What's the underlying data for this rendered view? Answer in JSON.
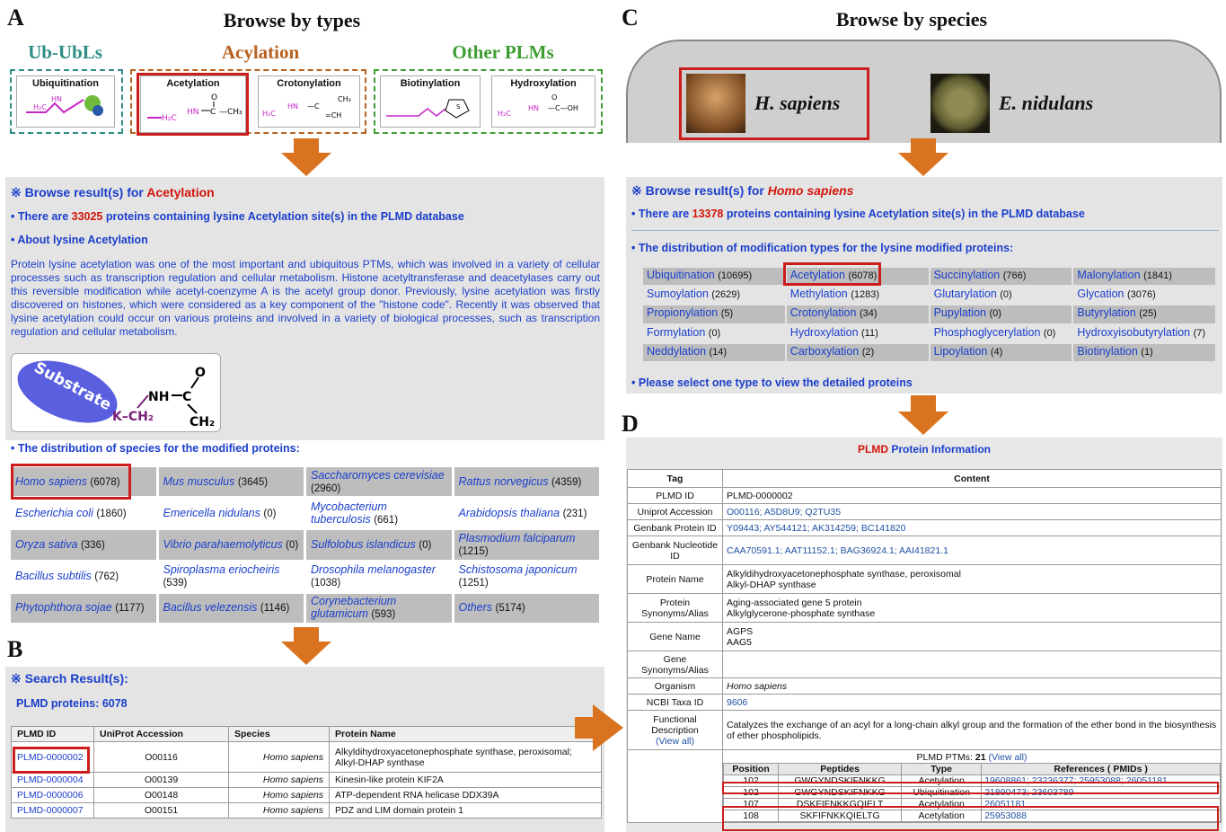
{
  "panels": {
    "a": "A",
    "b": "B",
    "c": "C",
    "d": "D"
  },
  "browse_types": {
    "title": "Browse by types",
    "categories": [
      {
        "label": "Ub-UbLs",
        "color": "#2e8d84"
      },
      {
        "label": "Acylation",
        "color": "#b8611e"
      },
      {
        "label": "Other PLMs",
        "color": "#3f9e33"
      }
    ],
    "types": [
      "Ubiquitination",
      "Acetylation",
      "Crotonylation",
      "Biotinylation",
      "Hydroxylation"
    ]
  },
  "acetyl_result": {
    "heading_prefix": "※ Browse result(s) for ",
    "heading_type": "Acetylation",
    "count_line_pre": "There are ",
    "count": "33025",
    "count_line_post": " proteins containing lysine Acetylation site(s) in the PLMD database",
    "about_heading": "About lysine Acetylation",
    "about_text": "Protein lysine acetylation was one of the most important and ubiquitous PTMs, which was involved in a variety of cellular processes such as transcription regulation and cellular metabolism. Histone acetyltransferase and deacetylases carry out this reversible modification while acetyl-coenzyme A is the acetyl group donor. Previously, lysine acetylation was firstly discovered on histones, which were considered as a key component of the \"histone code\". Recently it was observed that lysine acetylation could occur on various proteins and involved in a variety of biological processes, such as transcription regulation and cellular metabolism.",
    "substrate_label": "Substrate",
    "species_heading": "The distribution of species for the modified proteins:",
    "species": [
      {
        "name": "Homo sapiens",
        "count": "(6078)"
      },
      {
        "name": "Mus musculus",
        "count": "(3645)"
      },
      {
        "name": "Saccharomyces cerevisiae",
        "count": "(2960)"
      },
      {
        "name": "Rattus norvegicus",
        "count": "(4359)"
      },
      {
        "name": "Escherichia coli",
        "count": "(1860)"
      },
      {
        "name": "Emericella nidulans",
        "count": "(0)"
      },
      {
        "name": "Mycobacterium tuberculosis",
        "count": "(661)"
      },
      {
        "name": "Arabidopsis thaliana",
        "count": "(231)"
      },
      {
        "name": "Oryza sativa",
        "count": "(336)"
      },
      {
        "name": "Vibrio parahaemolyticus",
        "count": "(0)"
      },
      {
        "name": "Sulfolobus islandicus",
        "count": "(0)"
      },
      {
        "name": "Plasmodium falciparum",
        "count": "(1215)"
      },
      {
        "name": "Bacillus subtilis",
        "count": "(762)"
      },
      {
        "name": "Spiroplasma eriocheiris",
        "count": "(539)"
      },
      {
        "name": "Drosophila melanogaster",
        "count": "(1038)"
      },
      {
        "name": "Schistosoma japonicum",
        "count": "(1251)"
      },
      {
        "name": "Phytophthora sojae",
        "count": "(1177)"
      },
      {
        "name": "Bacillus velezensis",
        "count": "(1146)"
      },
      {
        "name": "Corynebacterium glutamicum",
        "count": "(593)"
      },
      {
        "name": "Others",
        "count": "(5174)"
      }
    ]
  },
  "search_result": {
    "heading": "※ Search Result(s):",
    "subheading": "PLMD proteins: 6078",
    "columns": [
      "PLMD ID",
      "UniProt Accession",
      "Species",
      "Protein Name"
    ],
    "rows": [
      [
        "PLMD-0000002",
        "O00116",
        "Homo sapiens",
        "Alkyldihydroxyacetonephosphate synthase, peroxisomal; Alkyl-DHAP synthase"
      ],
      [
        "PLMD-0000004",
        "O00139",
        "Homo sapiens",
        "Kinesin-like protein KIF2A"
      ],
      [
        "PLMD-0000006",
        "O00148",
        "Homo sapiens",
        "ATP-dependent RNA helicase DDX39A"
      ],
      [
        "PLMD-0000007",
        "O00151",
        "Homo sapiens",
        "PDZ and LIM domain protein 1"
      ]
    ]
  },
  "browse_species": {
    "title": "Browse by species",
    "species": [
      "H. sapiens",
      "E. nidulans"
    ]
  },
  "hs_result": {
    "heading_prefix": "※ Browse result(s) for ",
    "heading_species": "Homo sapiens",
    "count_line_pre": "There are ",
    "count": "13378",
    "count_line_post": " proteins containing lysine Acetylation site(s) in the PLMD database",
    "dist_heading": "The distribution of modification types for the lysine modified proteins:",
    "types": [
      {
        "name": "Ubiquitination",
        "count": "(10695)"
      },
      {
        "name": "Acetylation",
        "count": "(6078)"
      },
      {
        "name": "Succinylation",
        "count": "(766)"
      },
      {
        "name": "Malonylation",
        "count": "(1841)"
      },
      {
        "name": "Sumoylation",
        "count": "(2629)"
      },
      {
        "name": "Methylation",
        "count": "(1283)"
      },
      {
        "name": "Glutarylation",
        "count": "(0)"
      },
      {
        "name": "Glycation",
        "count": "(3076)"
      },
      {
        "name": "Propionylation",
        "count": "(5)"
      },
      {
        "name": "Crotonylation",
        "count": "(34)"
      },
      {
        "name": "Pupylation",
        "count": "(0)"
      },
      {
        "name": "Butyrylation",
        "count": "(25)"
      },
      {
        "name": "Formylation",
        "count": "(0)"
      },
      {
        "name": "Hydroxylation",
        "count": "(11)"
      },
      {
        "name": "Phosphoglycerylation",
        "count": "(0)"
      },
      {
        "name": "Hydroxyisobutyrylation",
        "count": "(7)"
      },
      {
        "name": "Neddylation",
        "count": "(14)"
      },
      {
        "name": "Carboxylation",
        "count": "(2)"
      },
      {
        "name": "Lipoylation",
        "count": "(4)"
      },
      {
        "name": "Biotinylation",
        "count": "(1)"
      }
    ],
    "select_hint": "Please select one type to view the detailed proteins"
  },
  "protein_info": {
    "title_plmd": "PLMD",
    "title_rest": " Protein Information",
    "col_tag": "Tag",
    "col_content": "Content",
    "rows": [
      {
        "tag": "PLMD ID",
        "content": "PLMD-0000002"
      },
      {
        "tag": "Uniprot Accession",
        "content": "O00116; A5D8U9; Q2TU35"
      },
      {
        "tag": "Genbank Protein ID",
        "content": "Y09443; AY544121; AK314259; BC141820"
      },
      {
        "tag": "Genbank Nucleotide ID",
        "content": "CAA70591.1; AAT11152.1; BAG36924.1; AAI41821.1"
      },
      {
        "tag": "Protein Name",
        "content": "Alkyldihydroxyacetonephosphate synthase, peroxisomal\nAlkyl-DHAP synthase"
      },
      {
        "tag": "Protein Synonyms/Alias",
        "content": "Aging-associated gene 5 protein\nAlkylglycerone-phosphate synthase"
      },
      {
        "tag": "Gene Name",
        "content": "AGPS\nAAG5"
      },
      {
        "tag": "Gene Synonyms/Alias",
        "content": ""
      },
      {
        "tag": "Organism",
        "content": "Homo sapiens"
      },
      {
        "tag": "NCBI Taxa ID",
        "content": "9606"
      },
      {
        "tag": "Functional Description",
        "content": "Catalyzes the exchange of an acyl for a long-chain alkyl group and the formation of the ether bond in the biosynthesis of ether phospholipids."
      }
    ],
    "view_all": "(View all)",
    "ptm_label_pre": "PLMD PTMs: ",
    "ptm_count": "21",
    "ptm_view_all": "(View all)",
    "ptm_columns": [
      "Position",
      "Peptides",
      "Type",
      "References ( PMIDs )"
    ],
    "ptm_rows": [
      [
        "102",
        "GWGYNDSKIFNKKG",
        "Acetylation",
        "19608861; 23236377; 25953088; 26051181"
      ],
      [
        "102",
        "GWGYNDSKIFNKKG",
        "Ubiquitination",
        "21890473; 23603789"
      ],
      [
        "107",
        "DSKFIFNKKGQIELT",
        "Acetylation",
        "26051181"
      ],
      [
        "108",
        "SKFIFNKKQIELTG",
        "Acetylation",
        "25953088"
      ]
    ]
  },
  "colors": {
    "red_box": "#cc1d1d",
    "arrow": "#d9731f",
    "link_blue": "#1a3ecb",
    "highlight_red": "#d3150b"
  }
}
